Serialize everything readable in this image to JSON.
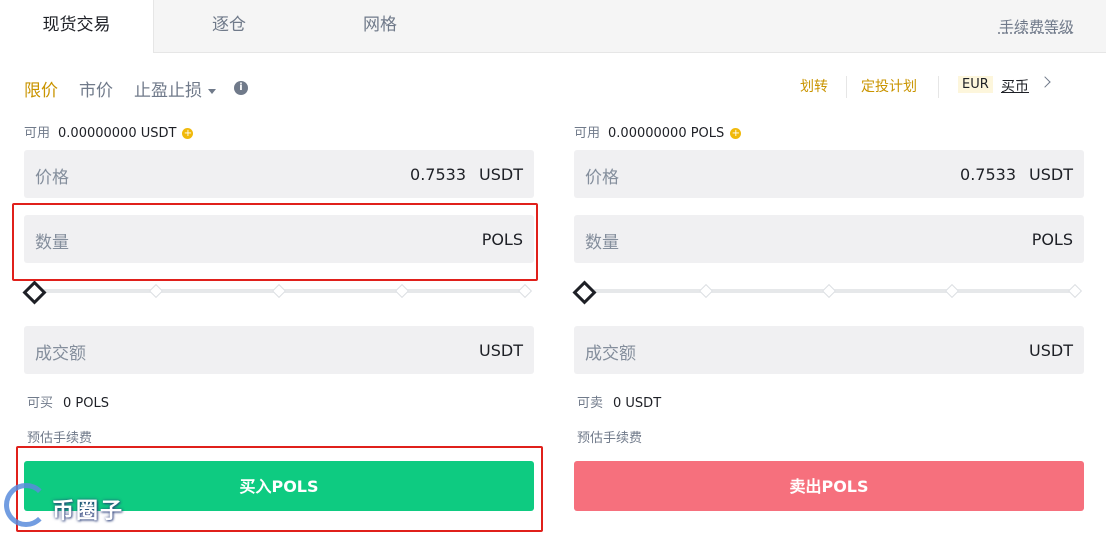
{
  "tabs": [
    {
      "label": "现货交易",
      "active": true
    },
    {
      "label": "逐仓",
      "active": false
    },
    {
      "label": "网格",
      "active": false
    }
  ],
  "fee_level": "手续费等级",
  "order_types": {
    "limit": "限价",
    "market": "市价",
    "stop": "止盈止损",
    "info_icon": "info-icon"
  },
  "right_links": {
    "transfer": "划转",
    "auto_invest": "定投计划",
    "fiat": "EUR",
    "buy_crypto": "买币",
    "arrow_icon": "chevron-right-icon"
  },
  "buy": {
    "available_label": "可用",
    "available_value": "0.00000000 USDT",
    "price_label": "价格",
    "price_value": "0.7533",
    "price_unit": "USDT",
    "amount_label": "数量",
    "amount_unit": "POLS",
    "total_label": "成交额",
    "total_unit": "USDT",
    "max_label": "可买",
    "max_value": "0 POLS",
    "fee_label": "预估手续费",
    "button": "买入POLS",
    "slider_percent": 0
  },
  "sell": {
    "available_label": "可用",
    "available_value": "0.00000000 POLS",
    "price_label": "价格",
    "price_value": "0.7533",
    "price_unit": "USDT",
    "amount_label": "数量",
    "amount_unit": "POLS",
    "total_label": "成交额",
    "total_unit": "USDT",
    "max_label": "可卖",
    "max_value": "0 USDT",
    "fee_label": "预估手续费",
    "button": "卖出POLS",
    "slider_percent": 0
  },
  "colors": {
    "accent": "#c99400",
    "buy": "#0ecb81",
    "sell": "#f6707d",
    "highlight": "#e0201b"
  },
  "watermark": "币圈子"
}
